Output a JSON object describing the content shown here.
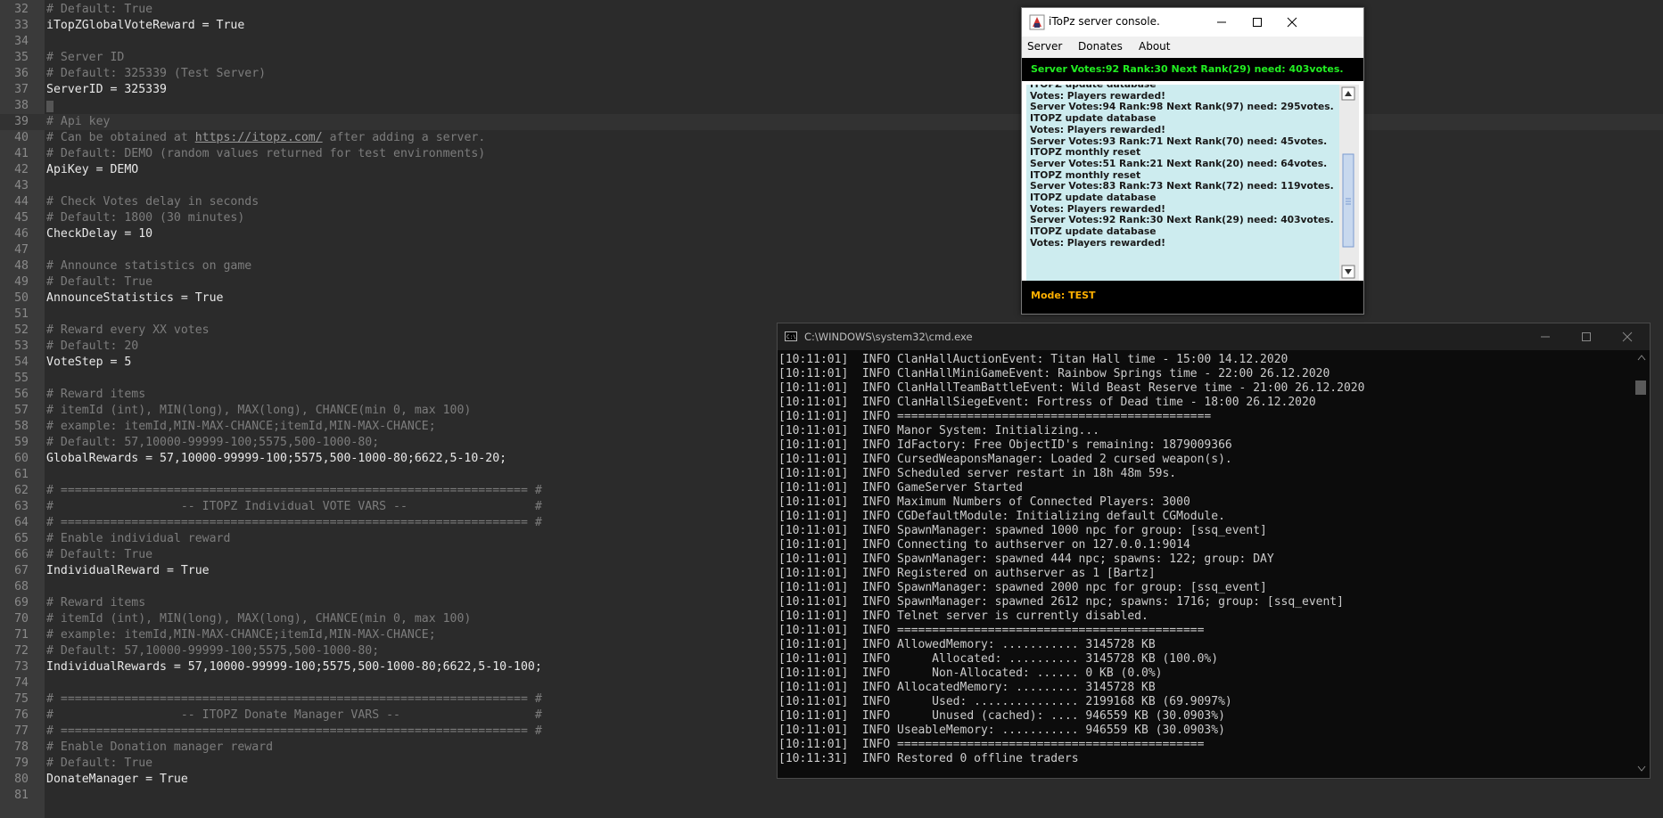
{
  "editor": {
    "current_line_index": 7,
    "url_text": "https://itopz.com/",
    "lines": [
      {
        "n": "32",
        "t": "# Default: True",
        "c": true
      },
      {
        "n": "33",
        "t": "iTopZGlobalVoteReward = True",
        "c": false
      },
      {
        "n": "34",
        "t": "",
        "c": false
      },
      {
        "n": "35",
        "t": "# Server ID",
        "c": true
      },
      {
        "n": "36",
        "t": "# Default: 325339 (Test Server)",
        "c": true
      },
      {
        "n": "37",
        "t": "ServerID = 325339",
        "c": false
      },
      {
        "n": "38",
        "t": "",
        "c": false
      },
      {
        "n": "39",
        "t": "# Api key",
        "c": true
      },
      {
        "n": "40",
        "t": "# Can be obtained at ",
        "c": true,
        "link": "https://itopz.com/",
        "after": " after adding a server."
      },
      {
        "n": "41",
        "t": "# Default: DEMO (random values returned for test environments)",
        "c": true
      },
      {
        "n": "42",
        "t": "ApiKey = DEMO",
        "c": false
      },
      {
        "n": "43",
        "t": "",
        "c": false
      },
      {
        "n": "44",
        "t": "# Check Votes delay in seconds",
        "c": true
      },
      {
        "n": "45",
        "t": "# Default: 1800 (30 minutes)",
        "c": true
      },
      {
        "n": "46",
        "t": "CheckDelay = 10",
        "c": false
      },
      {
        "n": "47",
        "t": "",
        "c": false
      },
      {
        "n": "48",
        "t": "# Announce statistics on game",
        "c": true
      },
      {
        "n": "49",
        "t": "# Default: True",
        "c": true
      },
      {
        "n": "50",
        "t": "AnnounceStatistics = True",
        "c": false
      },
      {
        "n": "51",
        "t": "",
        "c": false
      },
      {
        "n": "52",
        "t": "# Reward every XX votes",
        "c": true
      },
      {
        "n": "53",
        "t": "# Default: 20",
        "c": true
      },
      {
        "n": "54",
        "t": "VoteStep = 5",
        "c": false
      },
      {
        "n": "55",
        "t": "",
        "c": false
      },
      {
        "n": "56",
        "t": "# Reward items",
        "c": true
      },
      {
        "n": "57",
        "t": "# itemId (int), MIN(long), MAX(long), CHANCE(min 0, max 100)",
        "c": true
      },
      {
        "n": "58",
        "t": "# example: itemId,MIN-MAX-CHANCE;itemId,MIN-MAX-CHANCE;",
        "c": true
      },
      {
        "n": "59",
        "t": "# Default: 57,10000-99999-100;5575,500-1000-80;",
        "c": true
      },
      {
        "n": "60",
        "t": "GlobalRewards = 57,10000-99999-100;5575,500-1000-80;6622,5-10-20;",
        "c": false
      },
      {
        "n": "61",
        "t": "",
        "c": false
      },
      {
        "n": "62",
        "t": "# ================================================================== #",
        "c": true
      },
      {
        "n": "63",
        "t": "#                  -- ITOPZ Individual VOTE VARS --                  #",
        "c": true
      },
      {
        "n": "64",
        "t": "# ================================================================== #",
        "c": true
      },
      {
        "n": "65",
        "t": "# Enable individual reward",
        "c": true
      },
      {
        "n": "66",
        "t": "# Default: True",
        "c": true
      },
      {
        "n": "67",
        "t": "IndividualReward = True",
        "c": false
      },
      {
        "n": "68",
        "t": "",
        "c": false
      },
      {
        "n": "69",
        "t": "# Reward items",
        "c": true
      },
      {
        "n": "70",
        "t": "# itemId (int), MIN(long), MAX(long), CHANCE(min 0, max 100)",
        "c": true
      },
      {
        "n": "71",
        "t": "# example: itemId,MIN-MAX-CHANCE;itemId,MIN-MAX-CHANCE;",
        "c": true
      },
      {
        "n": "72",
        "t": "# Default: 57,10000-99999-100;5575,500-1000-80;",
        "c": true
      },
      {
        "n": "73",
        "t": "IndividualRewards = 57,10000-99999-100;5575,500-1000-80;6622,5-10-100;",
        "c": false
      },
      {
        "n": "74",
        "t": "",
        "c": false
      },
      {
        "n": "75",
        "t": "# ================================================================== #",
        "c": true
      },
      {
        "n": "76",
        "t": "#                  -- ITOPZ Donate Manager VARS --                   #",
        "c": true
      },
      {
        "n": "77",
        "t": "# ================================================================== #",
        "c": true
      },
      {
        "n": "78",
        "t": "# Enable Donation manager reward",
        "c": true
      },
      {
        "n": "79",
        "t": "# Default: True",
        "c": true
      },
      {
        "n": "80",
        "t": "DonateManager = True",
        "c": false
      },
      {
        "n": "81",
        "t": "",
        "c": false
      }
    ]
  },
  "itopz_window": {
    "title": "iToPz server console.",
    "menu": [
      "Server",
      "Donates",
      "About"
    ],
    "status": "Server Votes:92 Rank:30 Next Rank(29) need: 403votes.",
    "log": [
      "ITOPZ update database",
      "Votes: Players rewarded!",
      "Server Votes:94 Rank:98 Next Rank(97) need: 295votes.",
      "ITOPZ update database",
      "Votes: Players rewarded!",
      "Server Votes:93 Rank:71 Next Rank(70) need: 45votes.",
      "ITOPZ monthly reset",
      "Server Votes:51 Rank:21 Next Rank(20) need: 64votes.",
      "ITOPZ monthly reset",
      "Server Votes:83 Rank:73 Next Rank(72) need: 119votes.",
      "ITOPZ update database",
      "Votes: Players rewarded!",
      "Server Votes:92 Rank:30 Next Rank(29) need: 403votes.",
      "ITOPZ update database",
      "Votes: Players rewarded!"
    ],
    "mode": "Mode: TEST",
    "colors": {
      "status_text": "#22ee22",
      "log_bg": "#cdecef",
      "mode_text": "#ffb000"
    }
  },
  "cmd_window": {
    "title": "C:\\WINDOWS\\system32\\cmd.exe",
    "lines": [
      "[10:11:01]  INFO ClanHallAuctionEvent: Titan Hall time - 15:00 14.12.2020",
      "[10:11:01]  INFO ClanHallMiniGameEvent: Rainbow Springs time - 22:00 26.12.2020",
      "[10:11:01]  INFO ClanHallTeamBattleEvent: Wild Beast Reserve time - 21:00 26.12.2020",
      "[10:11:01]  INFO ClanHallSiegeEvent: Fortress of Dead time - 18:00 26.12.2020",
      "[10:11:01]  INFO =============================================",
      "[10:11:01]  INFO Manor System: Initializing...",
      "[10:11:01]  INFO IdFactory: Free ObjectID's remaining: 1879009366",
      "[10:11:01]  INFO CursedWeaponsManager: Loaded 2 cursed weapon(s).",
      "[10:11:01]  INFO Scheduled server restart in 18h 48m 59s.",
      "[10:11:01]  INFO GameServer Started",
      "[10:11:01]  INFO Maximum Numbers of Connected Players: 3000",
      "[10:11:01]  INFO CGDefaultModule: Initializing default CGModule.",
      "[10:11:01]  INFO SpawnManager: spawned 1000 npc for group: [ssq_event]",
      "[10:11:01]  INFO Connecting to authserver on 127.0.0.1:9014",
      "[10:11:01]  INFO SpawnManager: spawned 444 npc; spawns: 122; group: DAY",
      "[10:11:01]  INFO Registered on authserver as 1 [Bartz]",
      "[10:11:01]  INFO SpawnManager: spawned 2000 npc for group: [ssq_event]",
      "[10:11:01]  INFO SpawnManager: spawned 2612 npc; spawns: 1716; group: [ssq_event]",
      "[10:11:01]  INFO Telnet server is currently disabled.",
      "[10:11:01]  INFO ============================================",
      "[10:11:01]  INFO AllowedMemory: ........... 3145728 KB",
      "[10:11:01]  INFO      Allocated: .......... 3145728 KB (100.0%)",
      "[10:11:01]  INFO      Non-Allocated: ...... 0 KB (0.0%)",
      "[10:11:01]  INFO AllocatedMemory: ......... 3145728 KB",
      "[10:11:01]  INFO      Used: ............... 2199168 KB (69.9097%)",
      "[10:11:01]  INFO      Unused (cached): .... 946559 KB (30.0903%)",
      "[10:11:01]  INFO UseableMemory: ........... 946559 KB (30.0903%)",
      "[10:11:01]  INFO ============================================",
      "[10:11:31]  INFO Restored 0 offline traders"
    ]
  }
}
